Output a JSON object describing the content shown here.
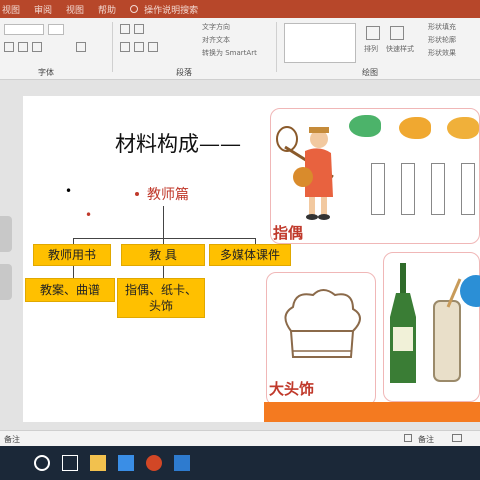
{
  "menu": {
    "items": [
      "视图",
      "审阅",
      "视图",
      "帮助"
    ],
    "tell_me": "操作说明搜索"
  },
  "ribbon": {
    "groups": [
      "字体",
      "段落",
      "绘图"
    ],
    "buttons": [
      "文字方向",
      "对齐文本",
      "转换为 SmartArt",
      "排列",
      "快速样式",
      "形状填充",
      "形状轮廓",
      "形状效果"
    ]
  },
  "slide": {
    "title": "材料构成——",
    "branch_teacher": "教师篇",
    "boxes": {
      "book": "教师用书",
      "tools": "教 具",
      "media": "多媒体课件",
      "book_items": "教案、曲谱",
      "tool_items": "指偶、纸卡、头饰"
    },
    "label_puppet": "指偶",
    "label_headwear": "大头饰"
  },
  "statusbar": {
    "notes_left": "备注",
    "notes_right": "备注"
  },
  "colors": {
    "ribbon_red": "#b7472a",
    "box_yellow": "#ffc000",
    "accent_red": "#c0392b",
    "accent_orange": "#f47a20"
  }
}
